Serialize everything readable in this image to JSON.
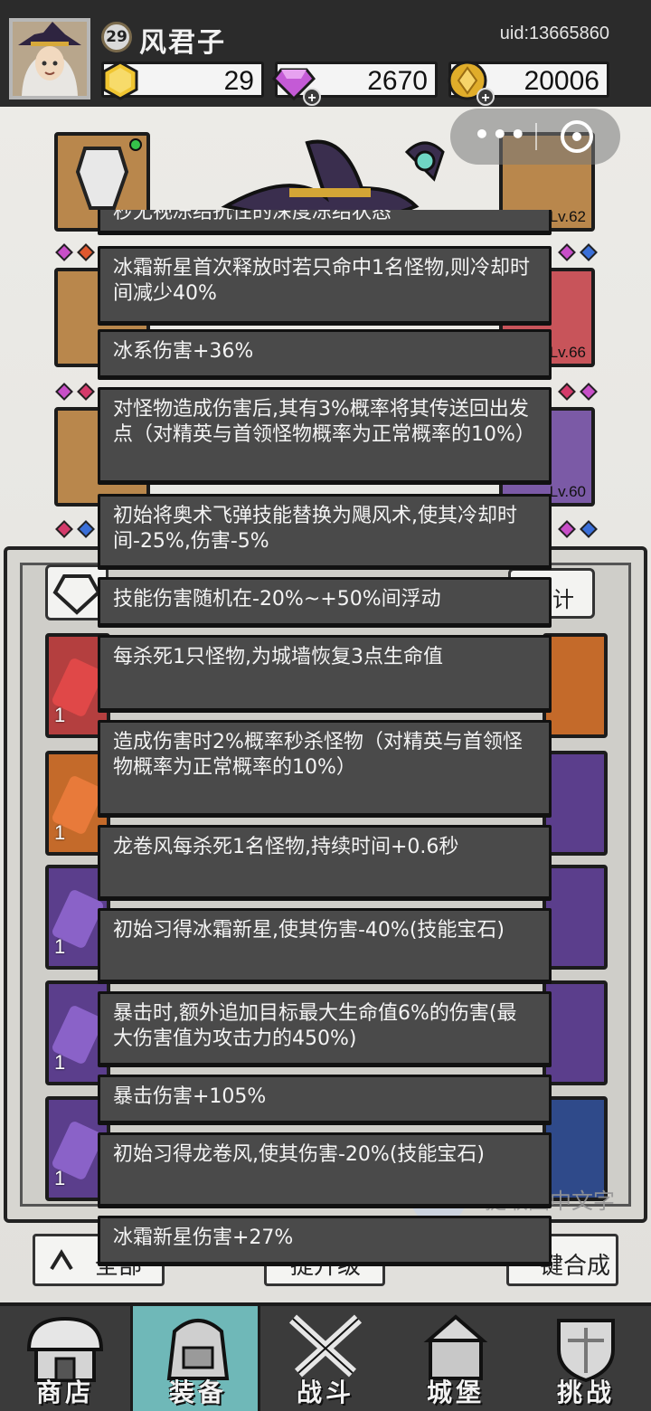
{
  "player": {
    "level": "29",
    "name": "风君子",
    "uid": "uid:13665860"
  },
  "resources": {
    "gold_gem": "29",
    "diamond": "2670",
    "coin": "20006"
  },
  "equipment": {
    "slot_levels": [
      "Lv.62",
      "Lv.66",
      "Lv.60"
    ]
  },
  "inventory": {
    "tab_right_label": "计",
    "item_counts": [
      "1",
      "1",
      "1",
      "1",
      "1"
    ],
    "buttons": {
      "all": "全部",
      "upgrade": "提升级",
      "compose": "键合成"
    }
  },
  "ocr": {
    "label": "提取图中文字",
    "icon": "text-scan-icon"
  },
  "tooltip": {
    "rows": [
      "秒无视冻结抗性的深度冻结状态",
      "冰霜新星首次释放时若只命中1名怪物,则冷却时间减少40%",
      "冰系伤害+36%",
      "对怪物造成伤害后,其有3%概率将其传送回出发点（对精英与首领怪物概率为正常概率的10%）",
      "初始将奥术飞弹技能替换为飓风术,使其冷却时间-25%,伤害-5%",
      "技能伤害随机在-20%~+50%间浮动",
      "每杀死1只怪物,为城墙恢复3点生命值",
      "造成伤害时2%概率秒杀怪物（对精英与首领怪物概率为正常概率的10%）",
      "龙卷风每杀死1名怪物,持续时间+0.6秒",
      "初始习得冰霜新星,使其伤害-40%(技能宝石)",
      "暴击时,额外追加目标最大生命值6%的伤害(最大伤害值为攻击力的450%)",
      "暴击伤害+105%",
      "初始习得龙卷风,使其伤害-20%(技能宝石)",
      "冰霜新星伤害+27%"
    ]
  },
  "nav": {
    "items": [
      {
        "label": "商店",
        "icon": "shop-icon"
      },
      {
        "label": "装备",
        "icon": "backpack-icon"
      },
      {
        "label": "战斗",
        "icon": "crossed-swords-icon"
      },
      {
        "label": "城堡",
        "icon": "castle-icon"
      },
      {
        "label": "挑战",
        "icon": "shield-icon"
      }
    ],
    "active_index": 1
  },
  "colors": {
    "topbar": "#2b2b2b",
    "tooltip_bg": "#4a4a4a",
    "nav_active": "#6fb8b8",
    "slot_orange": "#b9874c",
    "slot_purple": "#7b5aa6",
    "slot_red": "#c8545a"
  }
}
